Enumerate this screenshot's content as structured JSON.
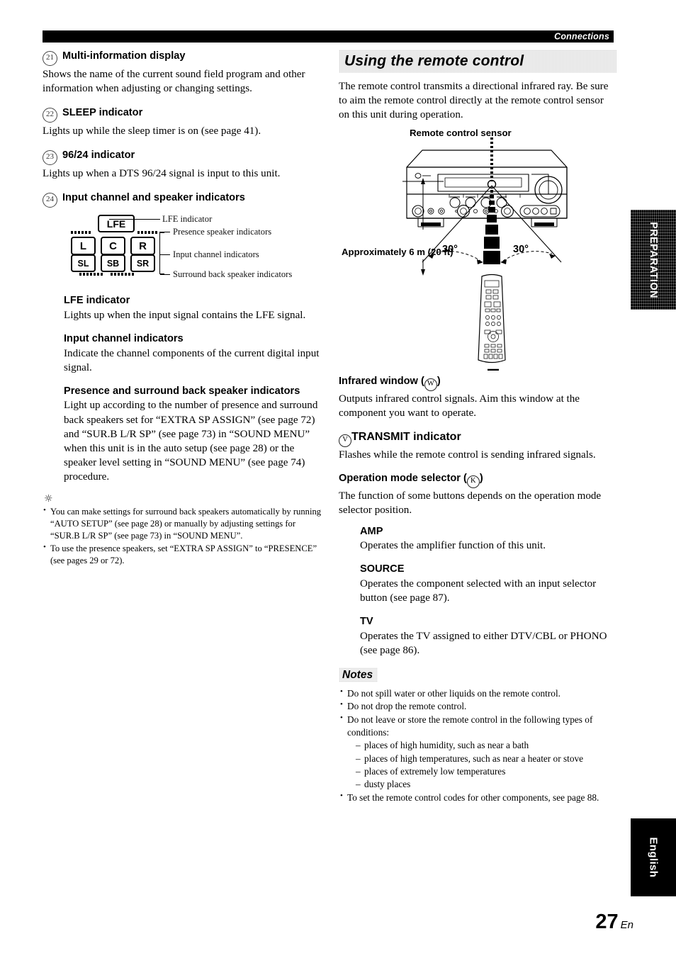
{
  "header": {
    "running_title": "Connections"
  },
  "page_footer": {
    "number": "27",
    "lang": "En"
  },
  "side_tabs": {
    "section": "PREPARATION",
    "language": "English"
  },
  "left_column": {
    "items": [
      {
        "num": "21",
        "title": "Multi-information display",
        "body": "Shows the name of the current sound field program and other information when adjusting or changing settings."
      },
      {
        "num": "22",
        "title": "SLEEP indicator",
        "body": "Lights up while the sleep timer is on (see page 41)."
      },
      {
        "num": "23",
        "title": "96/24 indicator",
        "body": "Lights up when a DTS 96/24 signal is input to this unit."
      },
      {
        "num": "24",
        "title": "Input channel and speaker indicators",
        "body": ""
      }
    ],
    "indicator_diagram": {
      "lfe_cell": "LFE",
      "row_main": [
        "L",
        "C",
        "R"
      ],
      "row_surround": [
        "SL",
        "SB",
        "SR"
      ],
      "labels": {
        "lfe": "LFE indicator",
        "presence": "Presence speaker indicators",
        "input_channel": "Input channel indicators",
        "surround_back": "Surround back speaker indicators"
      }
    },
    "subsections": [
      {
        "title": "LFE indicator",
        "body": "Lights up when the input signal contains the LFE signal."
      },
      {
        "title": "Input channel indicators",
        "body": "Indicate the channel components of the current digital input signal."
      },
      {
        "title": "Presence and surround back speaker indicators",
        "body": "Light up according to the number of presence and surround back speakers set for “EXTRA SP ASSIGN” (see page 72) and “SUR.B L/R SP” (see page 73) in “SOUND MENU” when this unit is in the auto setup (see page 28) or the speaker level setting in “SOUND MENU” (see page 74) procedure."
      }
    ],
    "tip": {
      "icon": "tip-sunburst-icon",
      "bullets": [
        "You can make settings for surround back speakers automatically by running “AUTO SETUP” (see page 28) or manually by adjusting settings for “SUR.B L/R SP” (see page 73) in “SOUND MENU”.",
        "To use the presence speakers, set “EXTRA SP ASSIGN” to “PRESENCE” (see pages 29 or 72)."
      ]
    }
  },
  "right_column": {
    "section_heading": "Using the remote control",
    "intro": "The remote control transmits a directional infrared ray. Be sure to aim the remote control directly at the remote control sensor on this unit during operation.",
    "figure": {
      "sensor_label": "Remote control sensor",
      "distance_label": "Approximately 6 m (20 ft)",
      "angle_left": "30°",
      "angle_right": "30°"
    },
    "subsections": [
      {
        "title": "Infrared window (",
        "circled": "W",
        "title_tail": ")",
        "body": "Outputs infrared control signals. Aim this window at the component you want to operate."
      },
      {
        "circled_lead": "V",
        "title": "TRANSMIT indicator",
        "body": "Flashes while the remote control is sending infrared signals."
      },
      {
        "title": "Operation mode selector (",
        "circled": "K",
        "title_tail": ")",
        "body": "The function of some buttons depends on the operation mode selector position."
      }
    ],
    "modes": [
      {
        "title": "AMP",
        "body": "Operates the amplifier function of this unit."
      },
      {
        "title": "SOURCE",
        "body": "Operates the component selected with an input selector button (see page 87)."
      },
      {
        "title": "TV",
        "body": "Operates the TV assigned to either DTV/CBL or PHONO (see page 86)."
      }
    ],
    "notes": {
      "heading": "Notes",
      "bullets": [
        {
          "text": "Do not spill water or other liquids on the remote control."
        },
        {
          "text": "Do not drop the remote control."
        },
        {
          "text": "Do not leave or store the remote control in the following types of conditions:",
          "dashes": [
            "places of high humidity, such as near a bath",
            "places of high temperatures, such as near a heater or stove",
            "places of extremely low temperatures",
            "dusty places"
          ]
        },
        {
          "text": "To set the remote control codes for other components, see page 88."
        }
      ]
    }
  }
}
